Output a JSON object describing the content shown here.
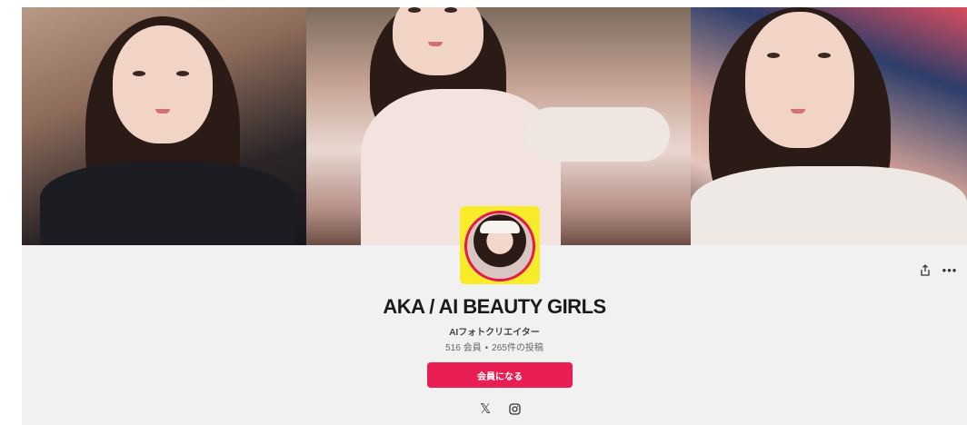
{
  "profile": {
    "name": "AKA / AI BEAUTY GIRLS",
    "tagline": "AIフォトクリエイター",
    "members": "516 会員",
    "posts": "265件の投稿",
    "separator": "•"
  },
  "actions": {
    "join_label": "会員になる",
    "share_icon": "share-icon",
    "more_label": "•••"
  },
  "social": {
    "x_glyph": "𝕏",
    "instagram_icon": "instagram-icon"
  },
  "colors": {
    "accent": "#e91e52",
    "avatar_frame": "#f8ec2a",
    "background": "#f1f1f1"
  }
}
